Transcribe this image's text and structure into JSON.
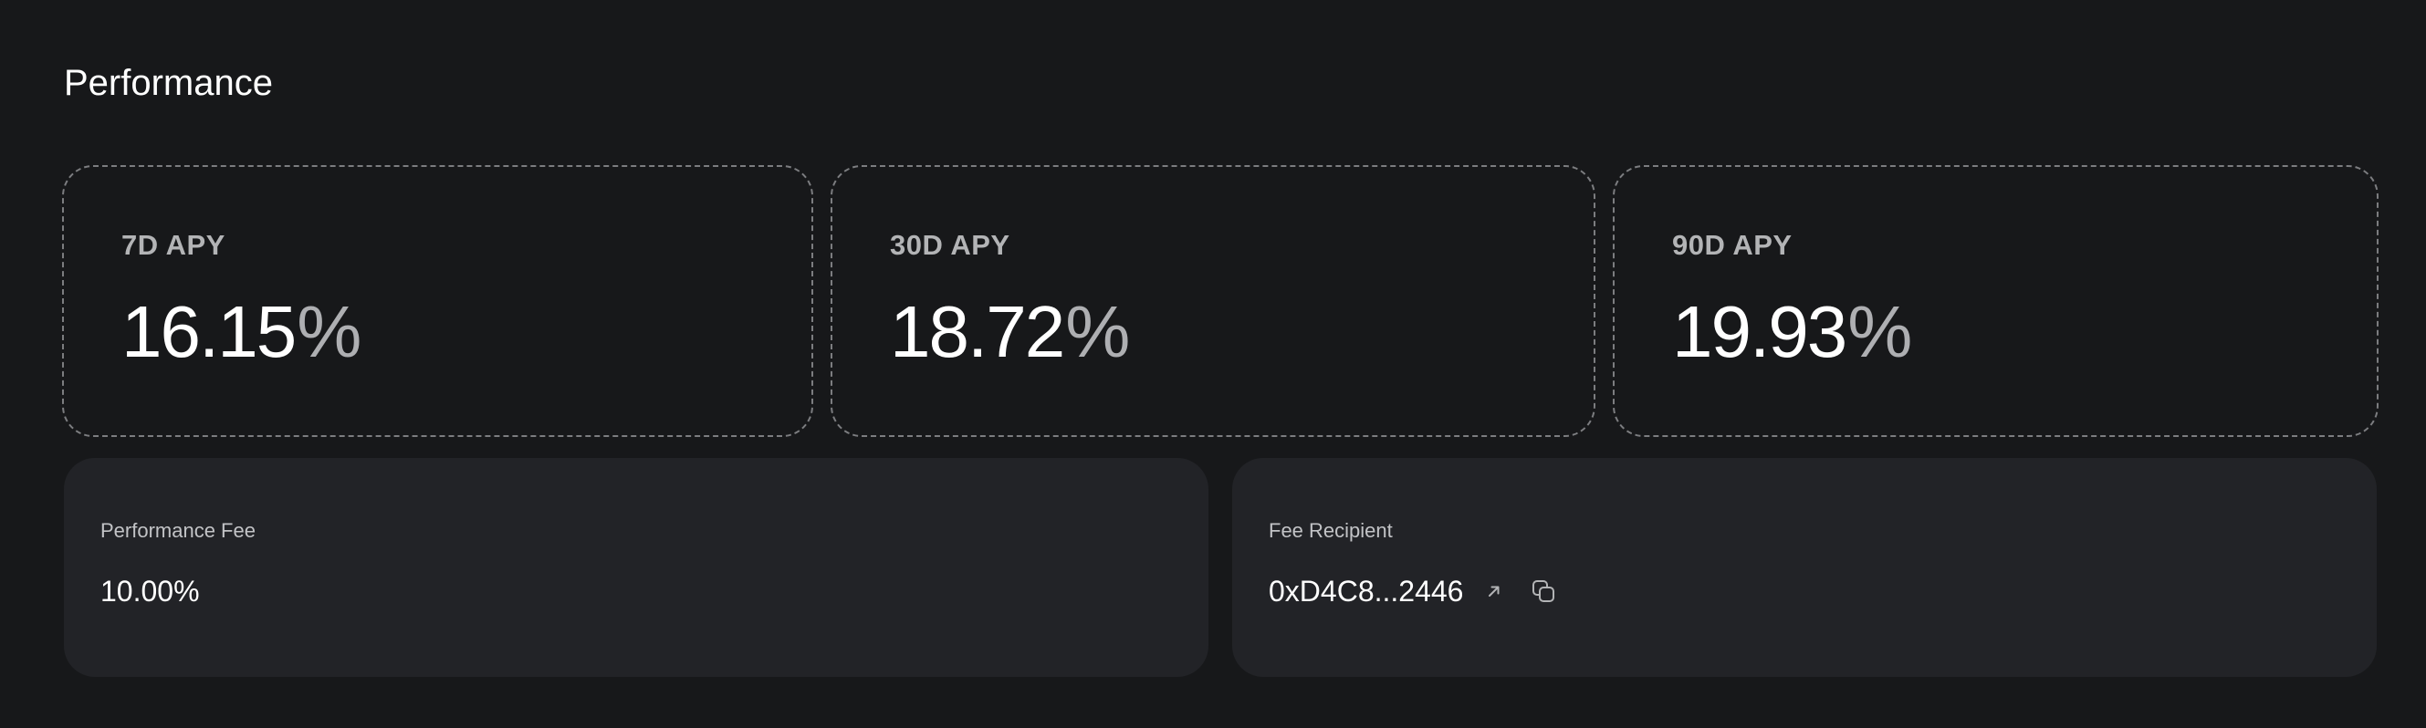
{
  "section": {
    "title": "Performance"
  },
  "apy_cards": [
    {
      "label": "7D APY",
      "value": "16.15",
      "unit": "%"
    },
    {
      "label": "30D APY",
      "value": "18.72",
      "unit": "%"
    },
    {
      "label": "90D APY",
      "value": "19.93",
      "unit": "%"
    }
  ],
  "performance_fee": {
    "label": "Performance Fee",
    "value": "10.00%"
  },
  "fee_recipient": {
    "label": "Fee Recipient",
    "address": "0xD4C8...2446",
    "icons": [
      "external-link-icon",
      "copy-icon"
    ]
  },
  "colors": {
    "background": "#17181a",
    "card_background": "#222327",
    "dashed_border": "#7c7d80",
    "muted_text": "#b3b4b6",
    "primary_text": "#ffffff"
  }
}
